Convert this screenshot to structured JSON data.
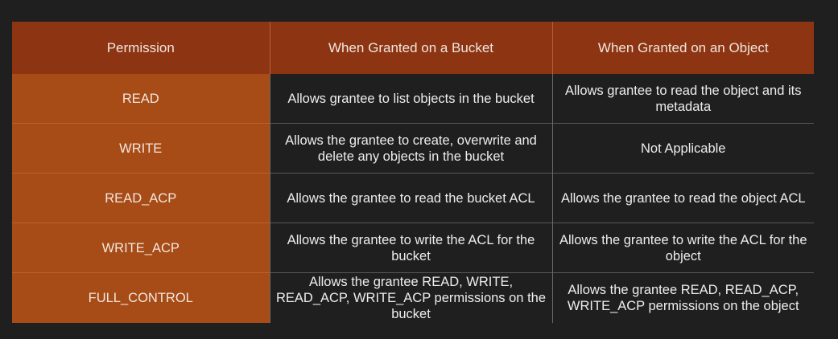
{
  "table": {
    "headers": [
      "Permission",
      "When Granted on a Bucket",
      "When Granted on an Object"
    ],
    "rows": [
      {
        "permission": "READ",
        "bucket": "Allows grantee to list objects in the bucket",
        "object": "Allows grantee to read the object and its metadata"
      },
      {
        "permission": "WRITE",
        "bucket": "Allows the grantee to create, overwrite and delete any objects in the bucket",
        "object": "Not Applicable"
      },
      {
        "permission": "READ_ACP",
        "bucket": "Allows the grantee to read the bucket ACL",
        "object": "Allows the grantee to read the object ACL"
      },
      {
        "permission": "WRITE_ACP",
        "bucket": "Allows the grantee to write the ACL for the bucket",
        "object": "Allows the grantee to write the ACL for the object"
      },
      {
        "permission": "FULL_CONTROL",
        "bucket": "Allows the grantee READ, WRITE, READ_ACP, WRITE_ACP permissions on the bucket",
        "object": "Allows the grantee READ, READ_ACP, WRITE_ACP permissions on the object"
      }
    ]
  },
  "colors": {
    "background": "#1f1f1f",
    "header_fill": "#8d3512",
    "permission_column_fill": "#a74b17",
    "text": "#ededed"
  }
}
